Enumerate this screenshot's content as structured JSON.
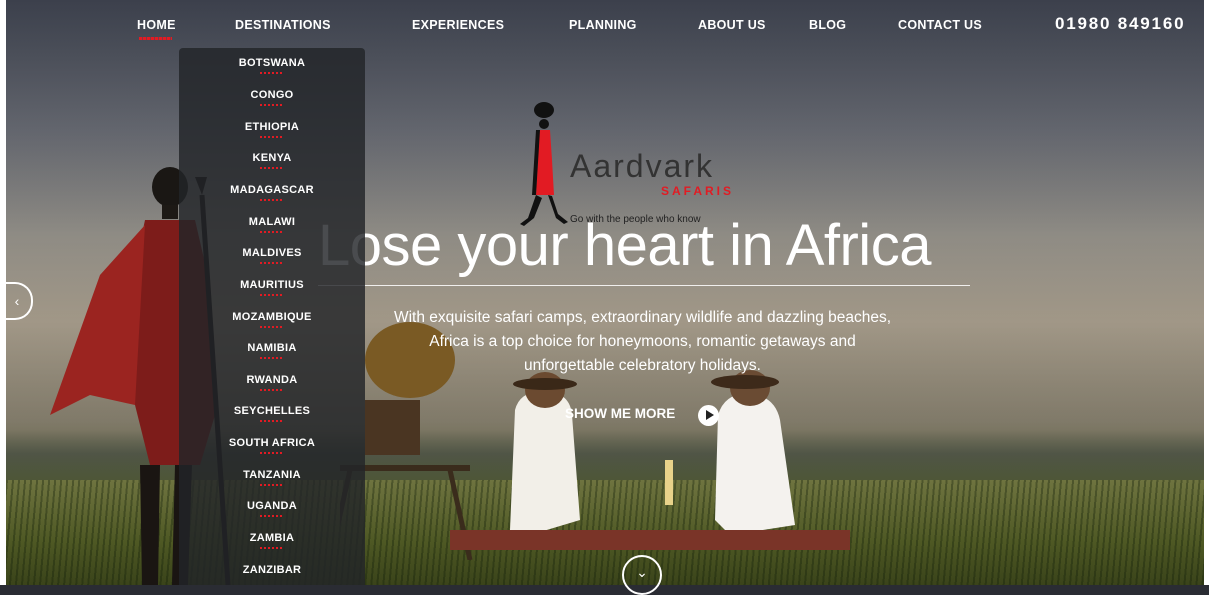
{
  "nav": {
    "items": [
      "HOME",
      "DESTINATIONS",
      "EXPERIENCES",
      "PLANNING",
      "ABOUT US",
      "BLOG",
      "CONTACT US"
    ],
    "phone": "01980 849160"
  },
  "dropdown": {
    "items": [
      "BOTSWANA",
      "CONGO",
      "ETHIOPIA",
      "KENYA",
      "MADAGASCAR",
      "MALAWI",
      "MALDIVES",
      "MAURITIUS",
      "MOZAMBIQUE",
      "NAMIBIA",
      "RWANDA",
      "SEYCHELLES",
      "SOUTH AFRICA",
      "TANZANIA",
      "UGANDA",
      "ZAMBIA",
      "ZANZIBAR"
    ]
  },
  "logo": {
    "name": "Aardvark",
    "sub": "SAFARIS",
    "tagline": "Go with the people who know"
  },
  "hero": {
    "headline": "Lose your heart in Africa",
    "subtext": "With exquisite safari camps, extraordinary wildlife and dazzling beaches, Africa is a top choice for honeymoons, romantic getaways and unforgettable celebratory holidays.",
    "cta_label": "SHOW ME MORE",
    "prev_glyph": "‹",
    "down_glyph": "⌄"
  },
  "colors": {
    "accent": "#e21b23",
    "dropdown_bg": "#222428"
  },
  "icons": {
    "prev": "chevron-left-icon",
    "down": "chevron-down-icon",
    "play": "play-icon"
  }
}
